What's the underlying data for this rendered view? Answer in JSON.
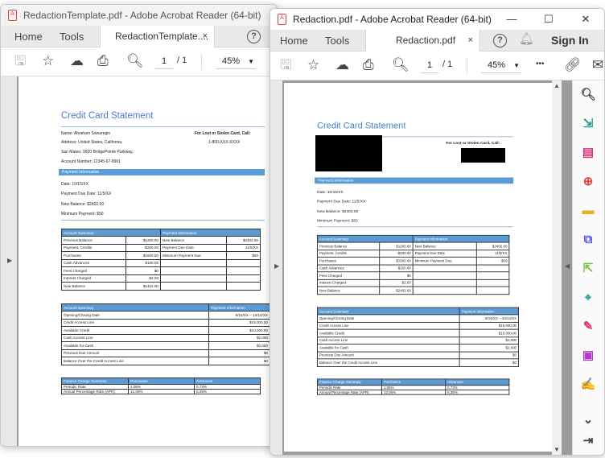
{
  "window1": {
    "title": "RedactionTemplate.pdf - Adobe Acrobat Reader (64-bit)",
    "nav": {
      "home": "Home",
      "tools": "Tools"
    },
    "tab_label": "RedactionTemplate....",
    "tab_close": "×",
    "help": "?",
    "page_current": "1",
    "page_total": "/ 1",
    "zoom": "45%"
  },
  "window2": {
    "title": "Redaction.pdf - Adobe Acrobat Reader (64-bit)",
    "nav": {
      "home": "Home",
      "tools": "Tools"
    },
    "tab_label": "Redaction.pdf",
    "tab_close": "×",
    "help": "?",
    "sign_in": "Sign In",
    "page_current": "1",
    "page_total": "/ 1",
    "zoom": "45%",
    "more": "•••",
    "window_controls": {
      "minimize": "—",
      "maximize": "☐",
      "close": "✕"
    },
    "tools_panel": [
      {
        "icon": "search-icon",
        "color": "#444"
      },
      {
        "icon": "export-pdf-icon",
        "color": "#1a9b94"
      },
      {
        "icon": "organize-pages-icon",
        "color": "#d6337a"
      },
      {
        "icon": "create-pdf-icon",
        "color": "#e0463c"
      },
      {
        "icon": "comment-icon",
        "color": "#e0b41a"
      },
      {
        "icon": "combine-files-icon",
        "color": "#5a5ae6"
      },
      {
        "icon": "compress-icon",
        "color": "#7ac143"
      },
      {
        "icon": "scan-icon",
        "color": "#1a9b94"
      },
      {
        "icon": "edit-pen-icon",
        "color": "#e0337a"
      },
      {
        "icon": "protect-icon",
        "color": "#b13ac9"
      },
      {
        "icon": "fill-sign-icon",
        "color": "#b13ac9"
      },
      {
        "icon": "chevron-down-icon",
        "color": "#444"
      },
      {
        "icon": "collapse-panel-icon",
        "color": "#444"
      }
    ]
  },
  "statement": {
    "title": "Credit Card Statement",
    "name": "Name: Abraham Swearegin",
    "address1": "Address: United States, California,",
    "address2": "San Mateo, 9920 BridgePointe Parkway,",
    "account": "Account Number: 12345-67-8901",
    "lost_card": "For Lost or Stolen Card, Call:",
    "phone": "1-800-XXX-XXXX",
    "payment_header": "Payment Information",
    "date": "Date: 10/15/XX",
    "due_date": "Payment Due Date: 11/5/XX",
    "new_balance": "New Balance: $2402.00",
    "min_payment": "Minimum Payment: $50",
    "table1": {
      "headers": [
        "Account Summary",
        "Payment Information"
      ],
      "rows": [
        [
          "Previous Balance",
          "$1200.00",
          "New Balance",
          "$2402.00"
        ],
        [
          "Payment, Credits",
          "-$200.00",
          "Payment Due Date",
          "11/5/XX"
        ],
        [
          "Purchases",
          "$1500.00",
          "Minimum Payment Due",
          "$50"
        ],
        [
          "Cash Advances",
          "$100.00",
          "",
          ""
        ],
        [
          "Fees Charged",
          "$0",
          "",
          ""
        ],
        [
          "Interest Charged",
          "$2.00",
          "",
          ""
        ],
        [
          "New Balance",
          "$2402.00",
          "",
          ""
        ]
      ]
    },
    "table2": {
      "headers": [
        "Account Summary",
        "Payment Information"
      ],
      "rows": [
        [
          "Opening/Closing Date",
          "9/15/XX – 10/14/XX"
        ],
        [
          "Credit Access Line",
          "$15,000.00"
        ],
        [
          "Available Credit",
          "$10,000.00"
        ],
        [
          "Cash Access Line",
          "$2,000"
        ],
        [
          "Available for Cash",
          "$2,000"
        ],
        [
          "Previous Due Amount",
          "$0"
        ],
        [
          "Balance Over the Credit Access Line",
          "$0"
        ]
      ]
    },
    "table3": {
      "headers": [
        "Finance Charge Summary",
        "Purchases",
        "Advances"
      ],
      "rows": [
        [
          "Periodic Rate",
          "1.05%",
          "0.73%"
        ],
        [
          "Annual Percentage Rate (APR)",
          "12.05%",
          "5.25%"
        ]
      ]
    }
  }
}
